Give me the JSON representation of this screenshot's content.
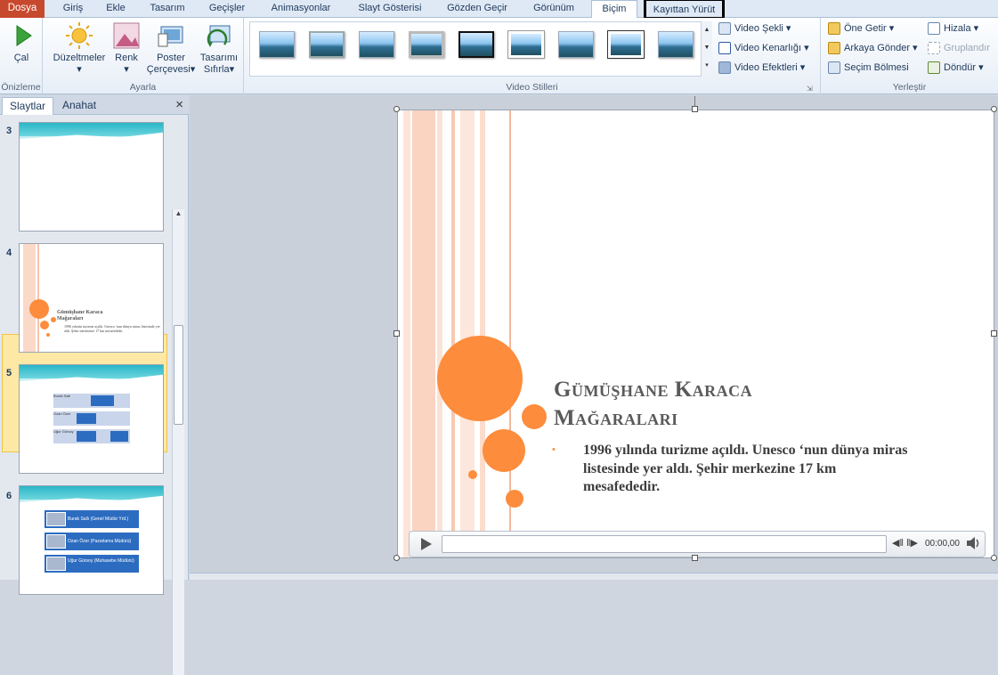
{
  "tabs": [
    {
      "label": "Dosya"
    },
    {
      "label": "Giriş"
    },
    {
      "label": "Ekle"
    },
    {
      "label": "Tasarım"
    },
    {
      "label": "Geçişler"
    },
    {
      "label": "Animasyonlar"
    },
    {
      "label": "Slayt Gösterisi"
    },
    {
      "label": "Gözden Geçir"
    },
    {
      "label": "Görünüm"
    },
    {
      "label": "Biçim"
    },
    {
      "label": "Kayıttan Yürüt"
    }
  ],
  "ribbon": {
    "preview_group": "Önizleme",
    "play_label": "Çal",
    "adjust_group": "Ayarla",
    "corrections_label": "Düzeltmeler",
    "color_label": "Renk",
    "poster_frame_label_1": "Poster",
    "poster_frame_label_2": "Çerçevesi",
    "reset_design_label_1": "Tasarımı",
    "reset_design_label_2": "Sıfırla",
    "video_styles_group": "Video Stilleri",
    "video_shape": "Video Şekli",
    "video_border": "Video Kenarlığı",
    "video_effects": "Video Efektleri",
    "arrange_group": "Yerleştir",
    "bring_forward": "Öne Getir",
    "send_backward": "Arkaya Gönder",
    "selection_pane": "Seçim Bölmesi",
    "align": "Hizala",
    "group": "Gruplandır",
    "rotate": "Döndür"
  },
  "panel": {
    "tab_slides": "Slaytlar",
    "tab_outline": "Anahat",
    "close_glyph": "×",
    "slide_numbers": [
      "3",
      "4",
      "5",
      "6"
    ],
    "thumb4_title": "Gümüşhane Karaca Mağaraları",
    "thumb4_body": "1996 yılında turizme açıldı. Unesco 'nun dünya miras listesinde yer aldı. Şehir merkezine 17 km mesafededir.",
    "thumb5_rows": [
      "Burak Sallı",
      "Ozan Özer",
      "Uğur Gürsoy"
    ],
    "thumb6_rows": [
      "Burak Sallı (Genel Müdür Yrd.)",
      "Ozan Özer (Pazarlama Müdürü)",
      "Uğur Gürsoy (Muhasebe Müdürü)"
    ]
  },
  "slide": {
    "title": "Gümüşhane Karaca Mağaraları",
    "body": "1996 yılında turizme açıldı. Unesco ‘nun dünya miras listesinde yer aldı. Şehir merkezine 17 km mesafededir.",
    "bullet": "•",
    "player_time": "00:00,00"
  },
  "colors": {
    "accent_orange": "#fd8c3c",
    "file_tab": "#c6482d",
    "teal_wave": "#2ab6c7"
  }
}
